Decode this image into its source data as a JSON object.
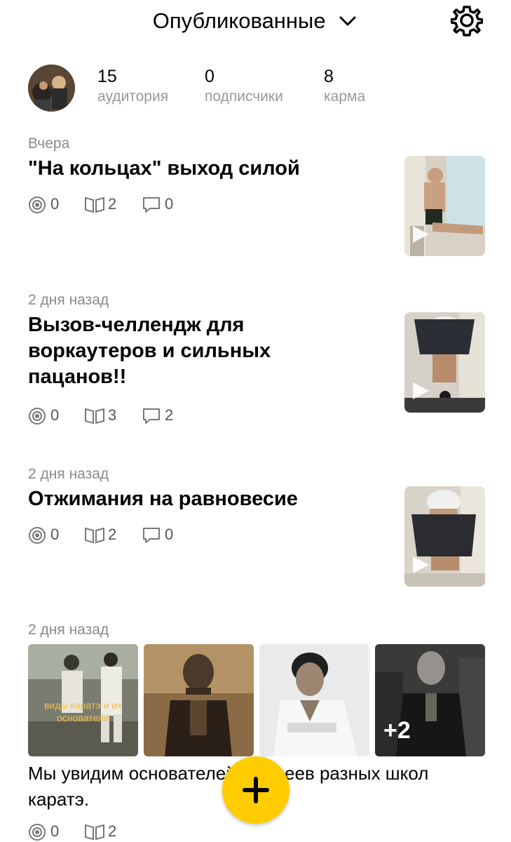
{
  "header": {
    "title": "Опубликованные"
  },
  "profile": {
    "stats": [
      {
        "value": "15",
        "label": "аудитория"
      },
      {
        "value": "0",
        "label": "подписчики"
      },
      {
        "value": "8",
        "label": "карма"
      }
    ]
  },
  "posts": [
    {
      "date": "Вчера",
      "title": "\"На кольцах\" выход силой",
      "views": "0",
      "reads": "2",
      "comments": "0"
    },
    {
      "date": "2 дня назад",
      "title": "Вызов-челлендж для воркаутеров и сильных пацанов!!",
      "views": "0",
      "reads": "3",
      "comments": "2"
    },
    {
      "date": "2 дня назад",
      "title": "Отжимания на равновесие",
      "views": "0",
      "reads": "2",
      "comments": "0"
    },
    {
      "date": "2 дня назад",
      "gallery_caption": "виды каратэ и их основатели",
      "more_count": "+2",
      "text": "Мы увидим основателей, сенсеев разных школ каратэ.",
      "views": "0",
      "reads": "2"
    }
  ],
  "colors": {
    "accent": "#ffcc00",
    "muted": "#8a8a8a"
  }
}
